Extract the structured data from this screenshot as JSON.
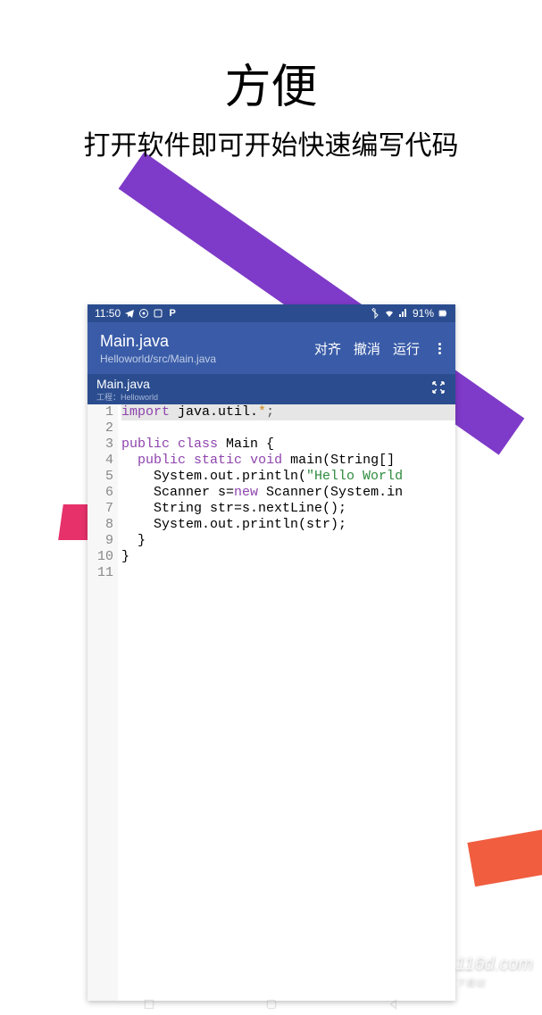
{
  "hero": {
    "title": "方便",
    "subtitle": "打开软件即可开始快速编写代码"
  },
  "status": {
    "time": "11:50",
    "battery": "91%"
  },
  "appbar": {
    "title": "Main.java",
    "subtitle": "Helloworld/src/Main.java",
    "actions": {
      "align": "对齐",
      "undo": "撤消",
      "run": "运行"
    }
  },
  "tab": {
    "name": "Main.java",
    "sub": "工程：Helloworld"
  },
  "code": {
    "lines": [
      {
        "n": 1,
        "segments": [
          [
            "kw",
            "import"
          ],
          [
            "",
            " java.util."
          ],
          [
            "op",
            "*"
          ],
          [
            "dim",
            ";"
          ]
        ],
        "highlight": true
      },
      {
        "n": 2,
        "segments": []
      },
      {
        "n": 3,
        "segments": [
          [
            "kw",
            "public"
          ],
          [
            "",
            " "
          ],
          [
            "kw",
            "class"
          ],
          [
            "",
            " Main {"
          ]
        ]
      },
      {
        "n": 4,
        "segments": [
          [
            "",
            "  "
          ],
          [
            "kw",
            "public"
          ],
          [
            "",
            " "
          ],
          [
            "kw",
            "static"
          ],
          [
            "",
            " "
          ],
          [
            "kw",
            "void"
          ],
          [
            "",
            " main(String[]"
          ]
        ]
      },
      {
        "n": 5,
        "segments": [
          [
            "",
            "    System.out.println("
          ],
          [
            "str",
            "\"Hello World"
          ]
        ]
      },
      {
        "n": 6,
        "segments": [
          [
            "",
            "    Scanner s="
          ],
          [
            "kw",
            "new"
          ],
          [
            "",
            " Scanner(System.in"
          ]
        ]
      },
      {
        "n": 7,
        "segments": [
          [
            "",
            "    String str=s.nextLine();"
          ]
        ]
      },
      {
        "n": 8,
        "segments": [
          [
            "",
            "    System.out.println(str);"
          ]
        ]
      },
      {
        "n": 9,
        "segments": [
          [
            "",
            "  }"
          ]
        ]
      },
      {
        "n": 10,
        "segments": [
          [
            "",
            "}"
          ]
        ]
      },
      {
        "n": 11,
        "segments": []
      }
    ]
  },
  "watermark": {
    "main": "116d.com",
    "sub": "下载站"
  }
}
